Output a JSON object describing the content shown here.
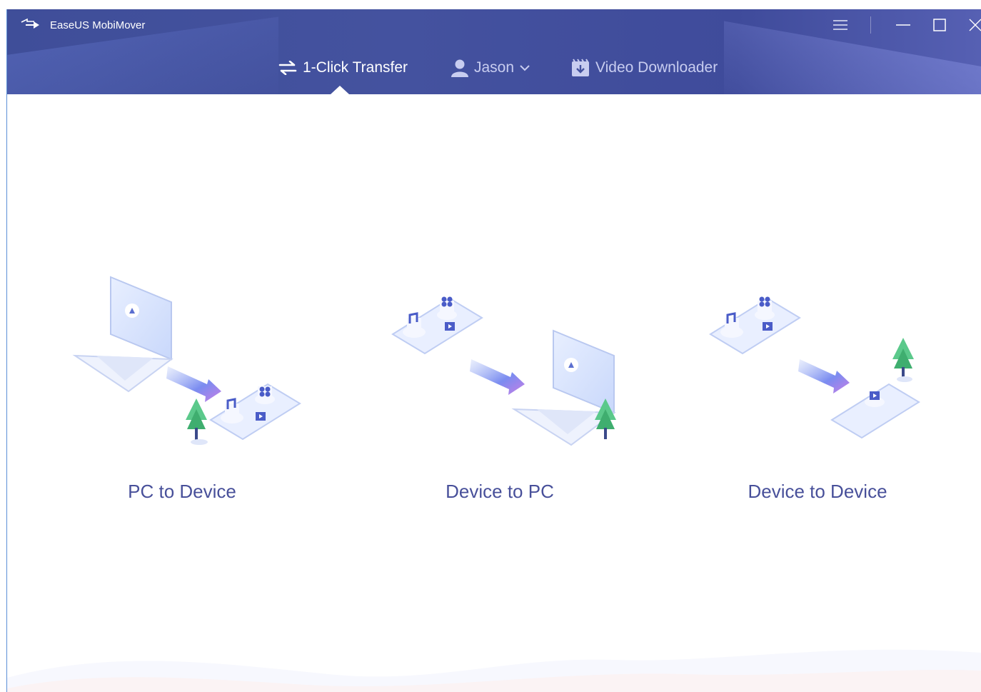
{
  "app": {
    "title": "EaseUS MobiMover",
    "logo_icon": "transfer-arrows-logo"
  },
  "window_controls": {
    "menu_icon": "hamburger-icon",
    "minimize_icon": "minimize-icon",
    "maximize_icon": "maximize-icon",
    "close_icon": "close-icon"
  },
  "nav": {
    "tabs": [
      {
        "label": "1-Click Transfer",
        "icon": "transfer-icon",
        "active": true
      },
      {
        "label": "Jason",
        "icon": "user-icon",
        "dropdown_icon": "chevron-down-icon",
        "active": false
      },
      {
        "label": "Video Downloader",
        "icon": "video-download-icon",
        "active": false
      }
    ]
  },
  "options": [
    {
      "label": "PC to Device",
      "illustration": "laptop-to-phone"
    },
    {
      "label": "Device to PC",
      "illustration": "phone-to-laptop"
    },
    {
      "label": "Device to Device",
      "illustration": "phone-to-phone"
    }
  ],
  "colors": {
    "header": "#44529f",
    "accent": "#48509a",
    "arrow_start": "#7b8cf0",
    "arrow_end": "#c77ee6"
  }
}
